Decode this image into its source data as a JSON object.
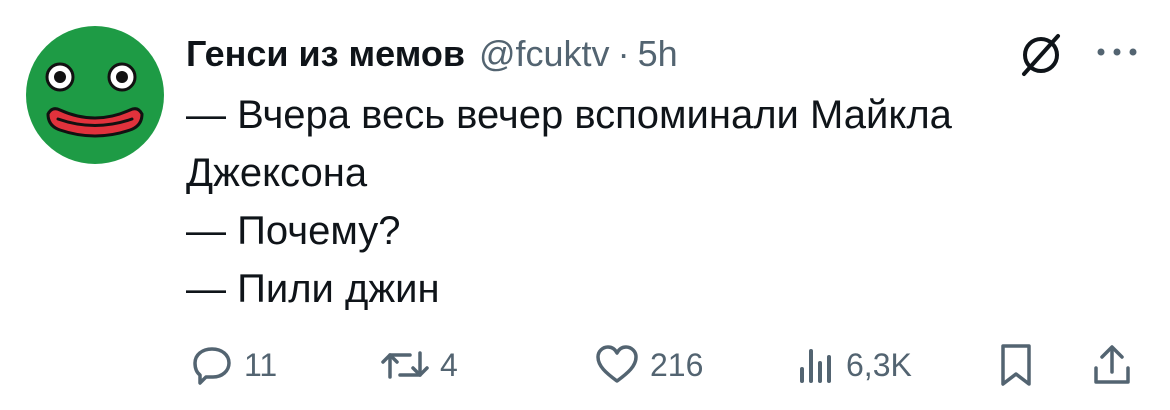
{
  "tweet": {
    "author": {
      "display_name": "Генси из мемов",
      "handle": "@fcuktv",
      "separator": "·",
      "time": "5h"
    },
    "lines": [
      "— Вчера весь вечер вспоминали Майкла",
      "Джексона",
      "— Почему?",
      "— Пили джин"
    ],
    "actions": {
      "replies": "11",
      "reposts": "4",
      "likes": "216",
      "views": "6,3K"
    }
  },
  "colors": {
    "text": "#0f1419",
    "muted": "#536471",
    "avatar_green": "#1e9b45",
    "avatar_mouth": "#e0323c"
  },
  "icons": {
    "grok": "grok-icon",
    "more": "more-dots-icon",
    "reply": "reply-icon",
    "repost": "repost-icon",
    "like": "heart-icon",
    "views": "views-icon",
    "bookmark": "bookmark-icon",
    "share": "share-icon"
  }
}
